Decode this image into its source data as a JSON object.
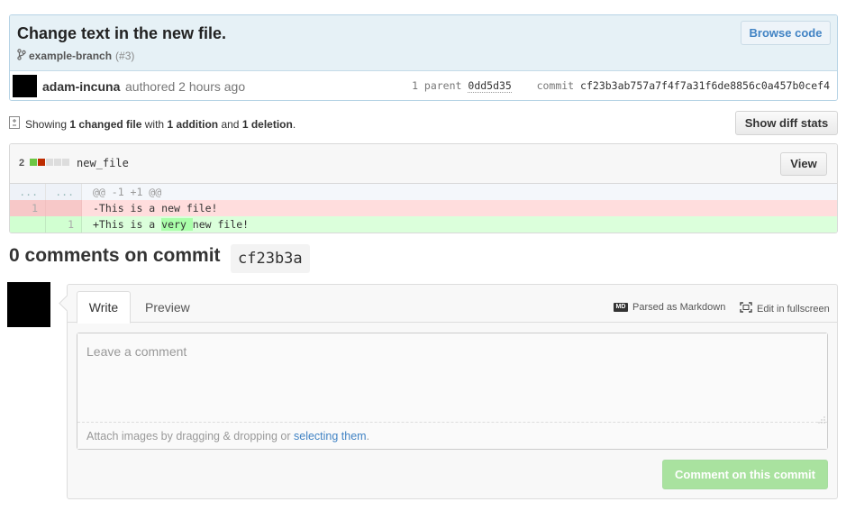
{
  "commit": {
    "title": "Change text in the new file.",
    "branch": "example-branch",
    "pr": "(#3)",
    "browse_label": "Browse code",
    "author": "adam-incuna",
    "authored": "authored 2 hours ago",
    "parent_label": "1 parent",
    "parent_sha": "0dd5d35",
    "commit_label": "commit",
    "commit_sha": "cf23b3ab757a7f4f7a31f6de8856c0a457b0cef4"
  },
  "stats": {
    "prefix": "Showing",
    "files": "1 changed file",
    "with": "with",
    "additions": "1 addition",
    "and": "and",
    "deletions": "1 deletion",
    "period": ".",
    "show_diff_stats": "Show diff stats"
  },
  "file": {
    "change_count": "2",
    "name": "new_file",
    "view_label": "View",
    "hunk_old_ln": "...",
    "hunk_new_ln": "...",
    "hunk": "@@ -1 +1 @@",
    "deleted_ln": "1",
    "deleted_line": "-This is a new file!",
    "added_ln": "1",
    "added_prefix": "+This is a ",
    "added_highlight": "very ",
    "added_suffix": "new file!"
  },
  "comments": {
    "heading": "0 comments on commit",
    "short_sha": "cf23b3a"
  },
  "form": {
    "tab_write": "Write",
    "tab_preview": "Preview",
    "markdown_icon": "MD",
    "markdown_hint": "Parsed as Markdown",
    "fullscreen_hint": "Edit in fullscreen",
    "placeholder": "Leave a comment",
    "attach_text": "Attach images by dragging & dropping or ",
    "attach_link": "selecting them",
    "attach_end": ".",
    "submit": "Comment on this commit"
  },
  "colors": {
    "accent_link": "#4183c4",
    "diff_added": "#dbffdb",
    "diff_deleted": "#ffdddd",
    "submit_disabled": "#a9e29f"
  }
}
